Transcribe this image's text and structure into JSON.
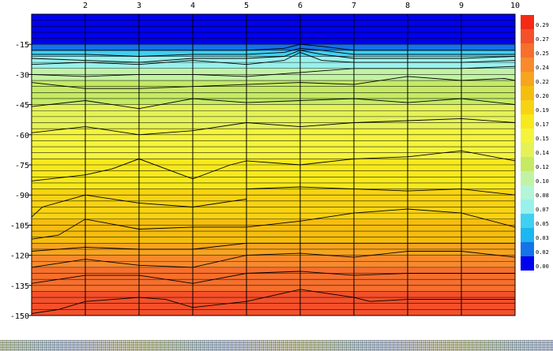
{
  "chart_data": {
    "type": "heatmap",
    "title": "",
    "xlabel": "",
    "ylabel": "",
    "xlim": [
      1,
      10
    ],
    "ylim": [
      -150,
      0
    ],
    "x_ticks": [
      2,
      3,
      4,
      5,
      6,
      7,
      8,
      9,
      10
    ],
    "y_ticks": [
      -15,
      -30,
      -45,
      -60,
      -75,
      -90,
      -105,
      -120,
      -135,
      -150
    ],
    "y_gridline_step": 3,
    "x_grid": true,
    "colorbar": {
      "placement": "right",
      "levels": [
        0.29,
        0.27,
        0.25,
        0.24,
        0.22,
        0.2,
        0.19,
        0.17,
        0.15,
        0.14,
        0.12,
        0.1,
        0.08,
        0.07,
        0.05,
        0.03,
        0.02,
        0.0
      ],
      "labels": [
        "0.29",
        "0.27",
        "0.25",
        "0.24",
        "0.22",
        "0.20",
        "0.19",
        "0.17",
        "0.15",
        "0.14",
        "0.12",
        "0.10",
        "0.08",
        "0.07",
        "0.05",
        "0.03",
        "0.02",
        "0.00"
      ],
      "colors": [
        "#f52a14",
        "#f4502a",
        "#f66f2d",
        "#f88a2c",
        "#f7a41f",
        "#f5bd0e",
        "#f8d313",
        "#f7e91c",
        "#f4f43d",
        "#e4f257",
        "#c5ea64",
        "#c2f3a5",
        "#b3f5d8",
        "#99f1ec",
        "#3fd0f2",
        "#1cb6f1",
        "#1473e8",
        "#0000ee"
      ]
    },
    "depth_bands": [
      {
        "top": 0,
        "bottom": -15,
        "value": 0.0
      },
      {
        "top": -15,
        "bottom": -18,
        "value": 0.02
      },
      {
        "top": -18,
        "bottom": -21,
        "value": 0.05
      },
      {
        "top": -21,
        "bottom": -27,
        "value": 0.07
      },
      {
        "top": -27,
        "bottom": -33,
        "value": 0.1
      },
      {
        "top": -33,
        "bottom": -45,
        "value": 0.12
      },
      {
        "top": -45,
        "bottom": -57,
        "value": 0.14
      },
      {
        "top": -57,
        "bottom": -72,
        "value": 0.15
      },
      {
        "top": -72,
        "bottom": -87,
        "value": 0.17
      },
      {
        "top": -87,
        "bottom": -102,
        "value": 0.19
      },
      {
        "top": -102,
        "bottom": -114,
        "value": 0.2
      },
      {
        "top": -114,
        "bottom": -120,
        "value": 0.22
      },
      {
        "top": -120,
        "bottom": -126,
        "value": 0.24
      },
      {
        "top": -126,
        "bottom": -138,
        "value": 0.25
      },
      {
        "top": -138,
        "bottom": -150,
        "value": 0.27
      }
    ],
    "contours": [
      {
        "value": 0.02,
        "points": [
          [
            1,
            -18
          ],
          [
            2,
            -18
          ],
          [
            3,
            -18
          ],
          [
            4,
            -18
          ],
          [
            5,
            -18
          ],
          [
            5.7,
            -17
          ],
          [
            6,
            -15
          ],
          [
            6.4,
            -16
          ],
          [
            7,
            -18
          ],
          [
            8,
            -18
          ],
          [
            9,
            -18
          ],
          [
            10,
            -18
          ]
        ]
      },
      {
        "value": 0.05,
        "points": [
          [
            1,
            -20
          ],
          [
            2,
            -20
          ],
          [
            3,
            -21
          ],
          [
            4,
            -20
          ],
          [
            5,
            -20
          ],
          [
            5.7,
            -19
          ],
          [
            6,
            -17
          ],
          [
            6.4,
            -18
          ],
          [
            7,
            -20
          ],
          [
            8,
            -20
          ],
          [
            9,
            -20
          ],
          [
            10,
            -20
          ]
        ]
      },
      {
        "value": 0.07,
        "points": [
          [
            1,
            -22
          ],
          [
            2,
            -23
          ],
          [
            3,
            -24
          ],
          [
            4,
            -22
          ],
          [
            5,
            -22
          ],
          [
            5.7,
            -21
          ],
          [
            6,
            -18
          ],
          [
            6.4,
            -20
          ],
          [
            7,
            -22
          ],
          [
            8,
            -22
          ],
          [
            9,
            -22
          ],
          [
            10,
            -21
          ]
        ]
      },
      {
        "value": 0.08,
        "points": [
          [
            1,
            -25
          ],
          [
            2,
            -24
          ],
          [
            3,
            -25
          ],
          [
            4,
            -23
          ],
          [
            5,
            -25
          ],
          [
            5.7,
            -23
          ],
          [
            6,
            -19
          ],
          [
            6.4,
            -23
          ],
          [
            7,
            -24
          ],
          [
            8,
            -24
          ],
          [
            9,
            -24
          ],
          [
            10,
            -23
          ]
        ]
      },
      {
        "value": 0.1,
        "points": [
          [
            1,
            -30
          ],
          [
            2,
            -31
          ],
          [
            3,
            -30
          ],
          [
            4,
            -30
          ],
          [
            5,
            -31
          ],
          [
            6,
            -29
          ],
          [
            7,
            -27
          ],
          [
            8,
            -27
          ],
          [
            9,
            -27
          ],
          [
            10,
            -26
          ]
        ]
      },
      {
        "value": 0.12,
        "points": [
          [
            1,
            -34
          ],
          [
            2,
            -37
          ],
          [
            3,
            -37
          ],
          [
            4,
            -36
          ],
          [
            5,
            -35
          ],
          [
            6,
            -34
          ],
          [
            7,
            -35
          ],
          [
            8,
            -31
          ],
          [
            9,
            -33
          ],
          [
            9.8,
            -32
          ],
          [
            10,
            -33
          ]
        ]
      },
      {
        "value": 0.14,
        "points": [
          [
            1,
            -46
          ],
          [
            2,
            -43
          ],
          [
            3,
            -47
          ],
          [
            4,
            -42
          ],
          [
            5,
            -44
          ],
          [
            6,
            -43
          ],
          [
            7,
            -42
          ],
          [
            8,
            -44
          ],
          [
            9,
            -42
          ],
          [
            10,
            -45
          ]
        ]
      },
      {
        "value": 0.15,
        "points": [
          [
            1,
            -59
          ],
          [
            2,
            -56
          ],
          [
            3,
            -60
          ],
          [
            4,
            -58
          ],
          [
            5,
            -54
          ],
          [
            6,
            -56
          ],
          [
            7,
            -54
          ],
          [
            8,
            -53
          ],
          [
            9,
            -52
          ],
          [
            10,
            -54
          ]
        ]
      },
      {
        "value": 0.17,
        "points": [
          [
            1,
            -83
          ],
          [
            2,
            -80
          ],
          [
            2.5,
            -77
          ],
          [
            3,
            -72
          ],
          [
            4,
            -82
          ],
          [
            4.7,
            -75
          ],
          [
            5,
            -73
          ],
          [
            6,
            -75
          ],
          [
            7,
            -72
          ],
          [
            8,
            -71
          ],
          [
            9,
            -68
          ],
          [
            10,
            -73
          ]
        ]
      },
      {
        "value": 0.19,
        "points": [
          [
            1,
            -101
          ],
          [
            1.2,
            -96
          ],
          [
            2,
            -90
          ],
          [
            3,
            -94
          ],
          [
            4,
            -96
          ],
          [
            5,
            -92
          ],
          [
            5,
            -87
          ],
          [
            6,
            -86
          ],
          [
            7,
            -87
          ],
          [
            8,
            -88
          ],
          [
            9,
            -87
          ],
          [
            10,
            -90
          ]
        ]
      },
      {
        "value": 0.2,
        "points": [
          [
            1,
            -112
          ],
          [
            1.5,
            -110
          ],
          [
            2,
            -102
          ],
          [
            3,
            -107
          ],
          [
            4,
            -106
          ],
          [
            5,
            -106
          ],
          [
            6,
            -103
          ],
          [
            7,
            -99
          ],
          [
            8,
            -97
          ],
          [
            9,
            -99
          ],
          [
            10,
            -106
          ]
        ]
      },
      {
        "value": 0.22,
        "points": [
          [
            1,
            -118
          ],
          [
            2,
            -116
          ],
          [
            3,
            -117
          ],
          [
            4,
            -117
          ],
          [
            5,
            -114
          ],
          [
            6,
            -114
          ],
          [
            7,
            -114
          ],
          [
            8,
            -114
          ],
          [
            9,
            -114
          ],
          [
            10,
            -114
          ]
        ]
      },
      {
        "value": 0.24,
        "points": [
          [
            1,
            -126
          ],
          [
            2,
            -122
          ],
          [
            3,
            -125
          ],
          [
            4,
            -126
          ],
          [
            5,
            -120
          ],
          [
            6,
            -119
          ],
          [
            7,
            -121
          ],
          [
            8,
            -118
          ],
          [
            9,
            -118
          ],
          [
            10,
            -121
          ]
        ]
      },
      {
        "value": 0.25,
        "points": [
          [
            1,
            -134
          ],
          [
            2,
            -130
          ],
          [
            3,
            -130
          ],
          [
            4,
            -134
          ],
          [
            5,
            -129
          ],
          [
            6,
            -128
          ],
          [
            7,
            -130
          ],
          [
            8,
            -129
          ],
          [
            9,
            -129
          ],
          [
            10,
            -129
          ]
        ]
      },
      {
        "value": 0.27,
        "points": [
          [
            1,
            -149
          ],
          [
            1.5,
            -147
          ],
          [
            2,
            -143
          ],
          [
            3,
            -141
          ],
          [
            3.5,
            -142
          ],
          [
            4,
            -146
          ],
          [
            5,
            -143
          ],
          [
            6,
            -137
          ],
          [
            7,
            -141
          ],
          [
            7.3,
            -143
          ],
          [
            8,
            -142
          ],
          [
            9,
            -142
          ],
          [
            10,
            -142
          ]
        ]
      }
    ]
  }
}
